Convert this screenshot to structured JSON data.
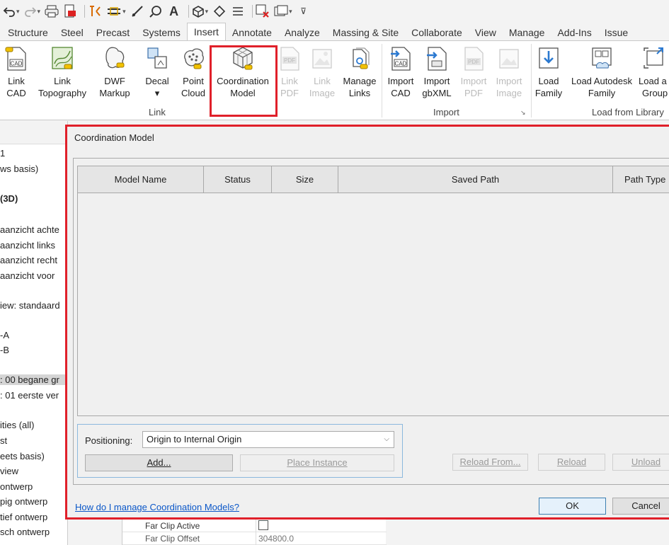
{
  "ribbon_tabs": [
    "Structure",
    "Steel",
    "Precast",
    "Systems",
    "Insert",
    "Annotate",
    "Analyze",
    "Massing & Site",
    "Collaborate",
    "View",
    "Manage",
    "Add-Ins",
    "Issue"
  ],
  "active_tab": "Insert",
  "ribbon": {
    "link_group": {
      "label": "Link",
      "buttons": [
        {
          "line1": "Link",
          "line2": "CAD",
          "icon": "link-cad-icon"
        },
        {
          "line1": "Link",
          "line2": "Topography",
          "icon": "link-topography-icon"
        },
        {
          "line1": "DWF",
          "line2": "Markup",
          "icon": "dwf-markup-icon"
        },
        {
          "line1": "Decal",
          "line2": "▾",
          "icon": "decal-icon"
        },
        {
          "line1": "Point",
          "line2": "Cloud",
          "icon": "point-cloud-icon"
        },
        {
          "line1": "Coordination",
          "line2": "Model",
          "icon": "coordination-model-icon"
        },
        {
          "line1": "Link",
          "line2": "PDF",
          "icon": "link-pdf-icon",
          "disabled": true
        },
        {
          "line1": "Link",
          "line2": "Image",
          "icon": "link-image-icon",
          "disabled": true
        },
        {
          "line1": "Manage",
          "line2": "Links",
          "icon": "manage-links-icon"
        }
      ]
    },
    "import_group": {
      "label": "Import",
      "buttons": [
        {
          "line1": "Import",
          "line2": "CAD",
          "icon": "import-cad-icon"
        },
        {
          "line1": "Import",
          "line2": "gbXML",
          "icon": "import-gbxml-icon"
        },
        {
          "line1": "Import",
          "line2": "PDF",
          "icon": "import-pdf-icon",
          "disabled": true
        },
        {
          "line1": "Import",
          "line2": "Image",
          "icon": "import-image-icon",
          "disabled": true
        }
      ]
    },
    "library_group": {
      "label": "Load from Library",
      "buttons": [
        {
          "line1": "Load",
          "line2": "Family",
          "icon": "load-family-icon"
        },
        {
          "line1": "Load Autodesk",
          "line2": "Family",
          "icon": "load-autodesk-family-icon"
        },
        {
          "line1": "Load a",
          "line2": "Group",
          "icon": "load-group-icon"
        }
      ]
    }
  },
  "browser": {
    "items": [
      {
        "text": "1"
      },
      {
        "text": "ws basis)"
      },
      {
        "text": "(3D)",
        "bold": true
      },
      {
        "text": "aanzicht achte"
      },
      {
        "text": "aanzicht links"
      },
      {
        "text": "aanzicht recht"
      },
      {
        "text": "aanzicht voor"
      },
      {
        "text": "iew: standaard"
      },
      {
        "text": "-A"
      },
      {
        "text": "-B"
      },
      {
        "text": ": 00 begane gr",
        "selected": true
      },
      {
        "text": ": 01 eerste ver"
      },
      {
        "text": "ities (all)"
      },
      {
        "text": "st"
      },
      {
        "text": "eets basis)"
      },
      {
        "text": "view"
      },
      {
        "text": "ontwerp"
      },
      {
        "text": "pig ontwerp"
      },
      {
        "text": "tief ontwerp"
      },
      {
        "text": "sch ontwerp"
      }
    ]
  },
  "properties": {
    "rows": [
      {
        "key": "Far Clip Active",
        "value": ""
      },
      {
        "key": "Far Clip Offset",
        "value": "304800.0"
      }
    ]
  },
  "dialog": {
    "title": "Coordination Model",
    "columns": [
      "Model Name",
      "Status",
      "Size",
      "Saved Path",
      "Path Type"
    ],
    "positioning_label": "Positioning:",
    "positioning_value": "Origin to Internal Origin",
    "add_button": "Add...",
    "place_instance_button": "Place Instance",
    "reload_from_button": "Reload From...",
    "reload_button": "Reload",
    "unload_button": "Unload",
    "help_link": "How do I manage Coordination Models?",
    "ok_button": "OK",
    "cancel_button": "Cancel"
  },
  "colors": {
    "highlight": "#e0202a",
    "link": "#0b57c8",
    "accent_blue": "#2b79d0"
  }
}
